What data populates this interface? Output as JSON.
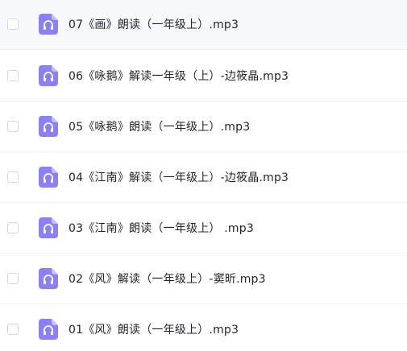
{
  "file_list": {
    "items": [
      {
        "name": "07《画》朗读（一年级上）.mp3",
        "type_icon": "audio-file-icon",
        "selected": false,
        "hovered": true
      },
      {
        "name": "06《咏鹅》解读一年级（上）-边筱晶.mp3",
        "type_icon": "audio-file-icon",
        "selected": false,
        "hovered": false
      },
      {
        "name": "05《咏鹅》朗读（一年级上）.mp3",
        "type_icon": "audio-file-icon",
        "selected": false,
        "hovered": false
      },
      {
        "name": "04《江南》解读（一年级上）-边筱晶.mp3",
        "type_icon": "audio-file-icon",
        "selected": false,
        "hovered": false
      },
      {
        "name": "03《江南》朗读（一年级上） .mp3",
        "type_icon": "audio-file-icon",
        "selected": false,
        "hovered": false
      },
      {
        "name": "02《风》解读（一年级上）-窦昕.mp3",
        "type_icon": "audio-file-icon",
        "selected": false,
        "hovered": false
      },
      {
        "name": "01《风》朗读（一年级上）.mp3",
        "type_icon": "audio-file-icon",
        "selected": false,
        "hovered": false
      }
    ]
  },
  "colors": {
    "icon_fill": "#8b80f9",
    "icon_fold": "#c4bfff",
    "text": "#1f2329"
  }
}
